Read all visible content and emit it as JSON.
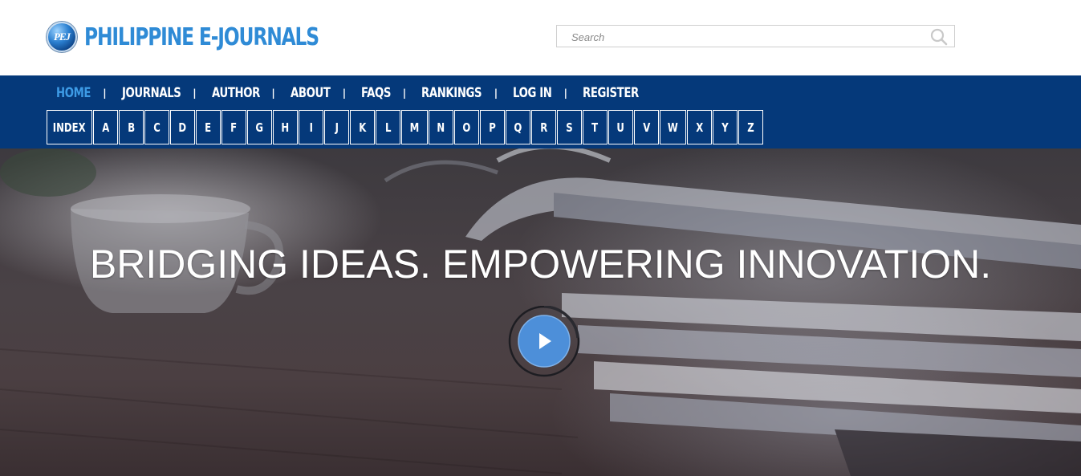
{
  "header": {
    "logo_badge": "PEJ",
    "logo_text": "PHILIPPINE E-JOURNALS",
    "search_placeholder": "Search"
  },
  "nav": {
    "items": [
      {
        "label": "HOME",
        "active": true
      },
      {
        "label": "JOURNALS"
      },
      {
        "label": "AUTHOR"
      },
      {
        "label": "ABOUT"
      },
      {
        "label": "FAQS"
      },
      {
        "label": "RANKINGS"
      },
      {
        "label": "LOG IN"
      },
      {
        "label": "REGISTER"
      }
    ],
    "separator": "|",
    "alphabet": [
      "INDEX",
      "A",
      "B",
      "C",
      "D",
      "E",
      "F",
      "G",
      "H",
      "I",
      "J",
      "K",
      "L",
      "M",
      "N",
      "O",
      "P",
      "Q",
      "R",
      "S",
      "T",
      "U",
      "V",
      "W",
      "X",
      "Y",
      "Z"
    ]
  },
  "hero": {
    "headline": "BRIDGING IDEAS. EMPOWERING INNOVATION."
  },
  "colors": {
    "navbar_bg": "#05397a",
    "logo_blue": "#2f8bd6",
    "active_menu": "#3d9be6",
    "play_button": "#4d8fd9"
  }
}
